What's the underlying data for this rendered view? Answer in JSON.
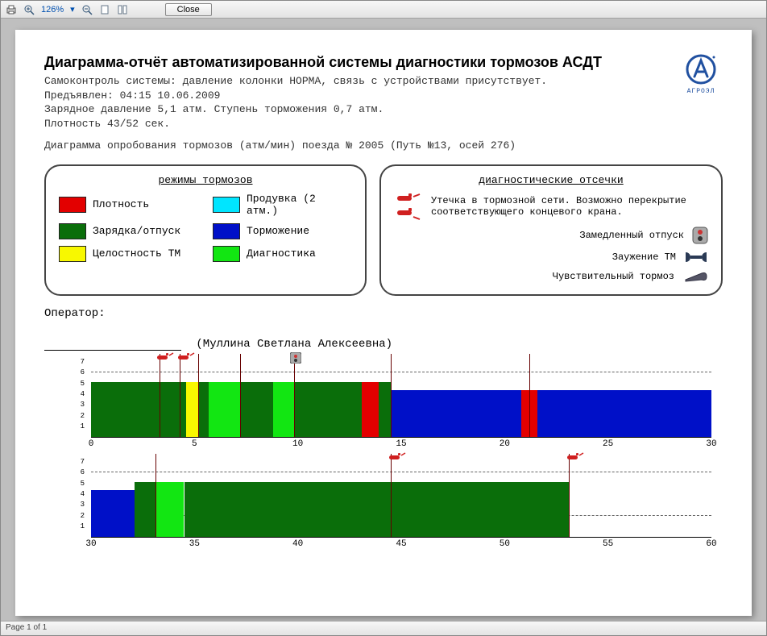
{
  "toolbar": {
    "zoom": "126%",
    "zoom_dropdown": "▾",
    "close_label": "Close"
  },
  "statusbar": {
    "page": "Page 1 of 1"
  },
  "report": {
    "title": "Диаграмма-отчёт автоматизированной системы диагностики тормозов АСДТ",
    "line1": "Самоконтроль системы: давление колонки НОРМА, связь с устройствами присутствует.",
    "line2": "Предъявлен: 04:15    10.06.2009",
    "line3": "Зарядное давление 5,1 атм. Ступень торможения 0,7 атм.",
    "line4": "Плотность 43/52 сек.",
    "diagram_line": "Диаграмма опробования тормозов (атм/мин) поезда № 2005 (Путь №13, осей 276)",
    "operator_label": "Оператор:",
    "operator_name": "(Муллина Светлана Алексеевна)"
  },
  "legend": {
    "title": "режимы тормозов",
    "items": [
      {
        "color": "#e30000",
        "label": "Плотность"
      },
      {
        "color": "#00e5ff",
        "label": "Продувка (2 атм.)"
      },
      {
        "color": "#0a6e0a",
        "label": "Зарядка/отпуск"
      },
      {
        "color": "#0010c8",
        "label": "Торможение"
      },
      {
        "color": "#f8f800",
        "label": "Целостность ТМ"
      },
      {
        "color": "#12e612",
        "label": "Диагностика"
      }
    ]
  },
  "diag": {
    "title": "диагностические отсечки",
    "leak_label": "Утечка в тормозной сети. Возможно перекрытие соответствующего концевого крана.",
    "slow_release": "Замедленный отпуск",
    "narrowing": "Заужение ТМ",
    "sensitive": "Чувствительный тормоз"
  },
  "logo_text": "АГРОЭЛ",
  "chart_data": [
    {
      "type": "bar",
      "x_range": [
        0,
        30
      ],
      "x_ticks": [
        0,
        5,
        10,
        15,
        20,
        25,
        30
      ],
      "y_range": [
        0,
        7
      ],
      "y_ticks": [
        1,
        2,
        3,
        4,
        5,
        6,
        7
      ],
      "dashed_y": [
        2,
        6
      ],
      "vlines": [
        3.3,
        4.3,
        5.2,
        7.2,
        9.8,
        14.5,
        21.2
      ],
      "markers": [
        {
          "type": "leak",
          "x": 3.6
        },
        {
          "type": "leak",
          "x": 4.6
        },
        {
          "type": "circ",
          "x": 9.9
        }
      ],
      "segments": [
        {
          "from": 0,
          "to": 4.6,
          "height": 5.1,
          "color": "#0a6e0a"
        },
        {
          "from": 4.6,
          "to": 5.2,
          "height": 5.1,
          "color": "#f8f800"
        },
        {
          "from": 5.2,
          "to": 5.7,
          "height": 5.1,
          "color": "#0a6e0a"
        },
        {
          "from": 5.7,
          "to": 7.2,
          "height": 5.1,
          "color": "#12e612"
        },
        {
          "from": 7.2,
          "to": 8.8,
          "height": 5.1,
          "color": "#0a6e0a"
        },
        {
          "from": 8.8,
          "to": 9.8,
          "height": 5.1,
          "color": "#12e612"
        },
        {
          "from": 9.8,
          "to": 13.1,
          "height": 5.1,
          "color": "#0a6e0a"
        },
        {
          "from": 13.1,
          "to": 13.9,
          "height": 5.1,
          "color": "#e30000"
        },
        {
          "from": 13.9,
          "to": 14.5,
          "height": 5.1,
          "color": "#0a6e0a"
        },
        {
          "from": 14.5,
          "to": 20.8,
          "height": 4.4,
          "color": "#0010c8"
        },
        {
          "from": 20.8,
          "to": 21.6,
          "height": 4.4,
          "color": "#e30000"
        },
        {
          "from": 21.6,
          "to": 30.0,
          "height": 4.4,
          "color": "#0010c8"
        }
      ]
    },
    {
      "type": "bar",
      "x_range": [
        30,
        60
      ],
      "x_ticks": [
        30,
        35,
        40,
        45,
        50,
        55,
        60
      ],
      "y_range": [
        0,
        7
      ],
      "y_ticks": [
        1,
        2,
        3,
        4,
        5,
        6,
        7
      ],
      "dashed_y": [
        2,
        6
      ],
      "vlines": [
        33.1,
        44.5,
        53.1
      ],
      "markers": [
        {
          "type": "leak",
          "x": 44.8
        },
        {
          "type": "leak",
          "x": 53.4
        }
      ],
      "segments": [
        {
          "from": 30.0,
          "to": 32.1,
          "height": 4.4,
          "color": "#0010c8"
        },
        {
          "from": 32.1,
          "to": 33.1,
          "height": 5.1,
          "color": "#0a6e0a"
        },
        {
          "from": 33.1,
          "to": 34.5,
          "height": 5.1,
          "color": "#12e612"
        },
        {
          "from": 34.5,
          "to": 53.1,
          "height": 5.1,
          "color": "#0a6e0a"
        }
      ]
    }
  ]
}
